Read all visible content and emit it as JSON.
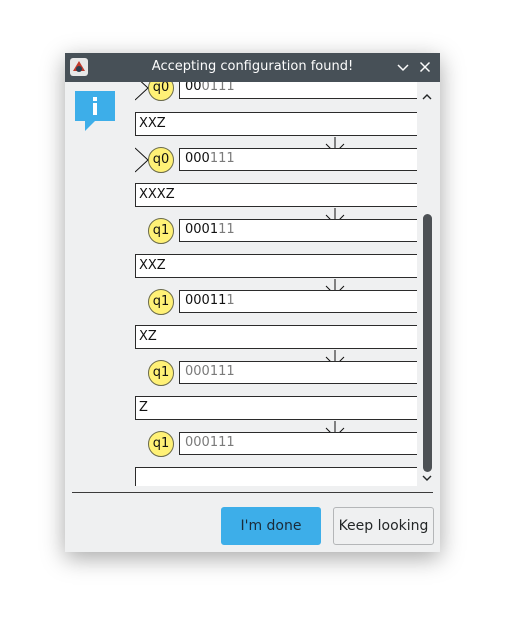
{
  "window": {
    "title": "Accepting configuration found!",
    "app_icon": "jflap-app-icon",
    "minimize_icon": "chevron-down-icon",
    "close_icon": "close-icon"
  },
  "message_icon": "info-icon",
  "configurations": [
    {
      "state": "q0",
      "is_start": true,
      "tape_read": "00",
      "tape_rest": "0111",
      "stack": "XXZ"
    },
    {
      "state": "q0",
      "is_start": true,
      "tape_read": "000",
      "tape_rest": "111",
      "stack": "XXXZ"
    },
    {
      "state": "q1",
      "is_start": false,
      "tape_read": "0001",
      "tape_rest": "11",
      "stack": "XXZ"
    },
    {
      "state": "q1",
      "is_start": false,
      "tape_read": "00011",
      "tape_rest": "1",
      "stack": "XZ"
    },
    {
      "state": "q1",
      "is_start": false,
      "tape_read": "000111",
      "tape_rest": "",
      "stack": "Z"
    },
    {
      "state": "q1",
      "is_start": false,
      "tape_read": "000111",
      "tape_rest": "",
      "stack": ""
    }
  ],
  "buttons": {
    "done": "I'm done",
    "keep": "Keep looking"
  },
  "colors": {
    "titlebar": "#475057",
    "dialog_bg": "#eff0f1",
    "primary_button": "#3daee9",
    "state_fill": "#fff176",
    "scrollbar_thumb": "#4d5155"
  }
}
